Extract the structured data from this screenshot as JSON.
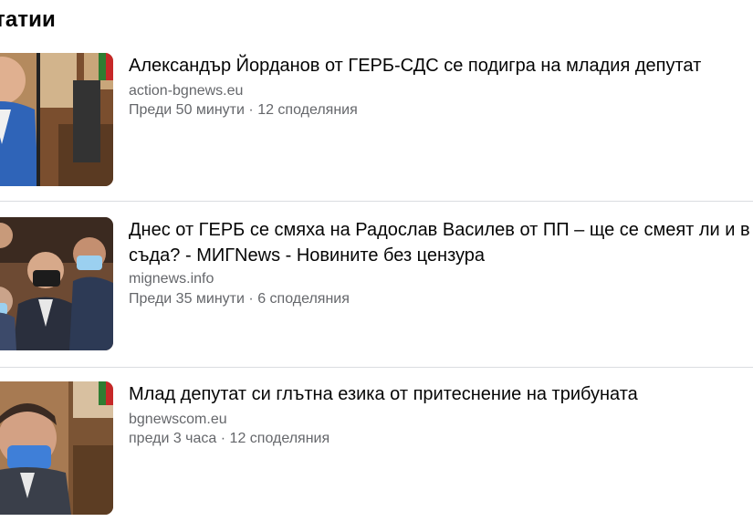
{
  "section": {
    "title": "татии"
  },
  "articles": [
    {
      "title": "Александър Йорданов от ГЕРБ-СДС се подигра на младия депутат",
      "source": "action-bgnews.eu",
      "time": "Преди 50 минути",
      "separator": "·",
      "shares": "12 споделяния"
    },
    {
      "title": "Днес от ГЕРБ се смяха на Радослав Василев от ПП – ще се смеят ли и в съда? - МИГNews - Новините без цензура",
      "source": "mignews.info",
      "time": "Преди 35 минути",
      "separator": "·",
      "shares": "6 споделяния"
    },
    {
      "title": "Млад депутат си глътна езика от притеснение на трибуната",
      "source": "bgnewscom.eu",
      "time": "преди 3 часа",
      "separator": "·",
      "shares": "12 споделяния"
    }
  ],
  "colors": {
    "text": "#050505",
    "secondary": "#65676b",
    "divider": "#dadde1"
  }
}
